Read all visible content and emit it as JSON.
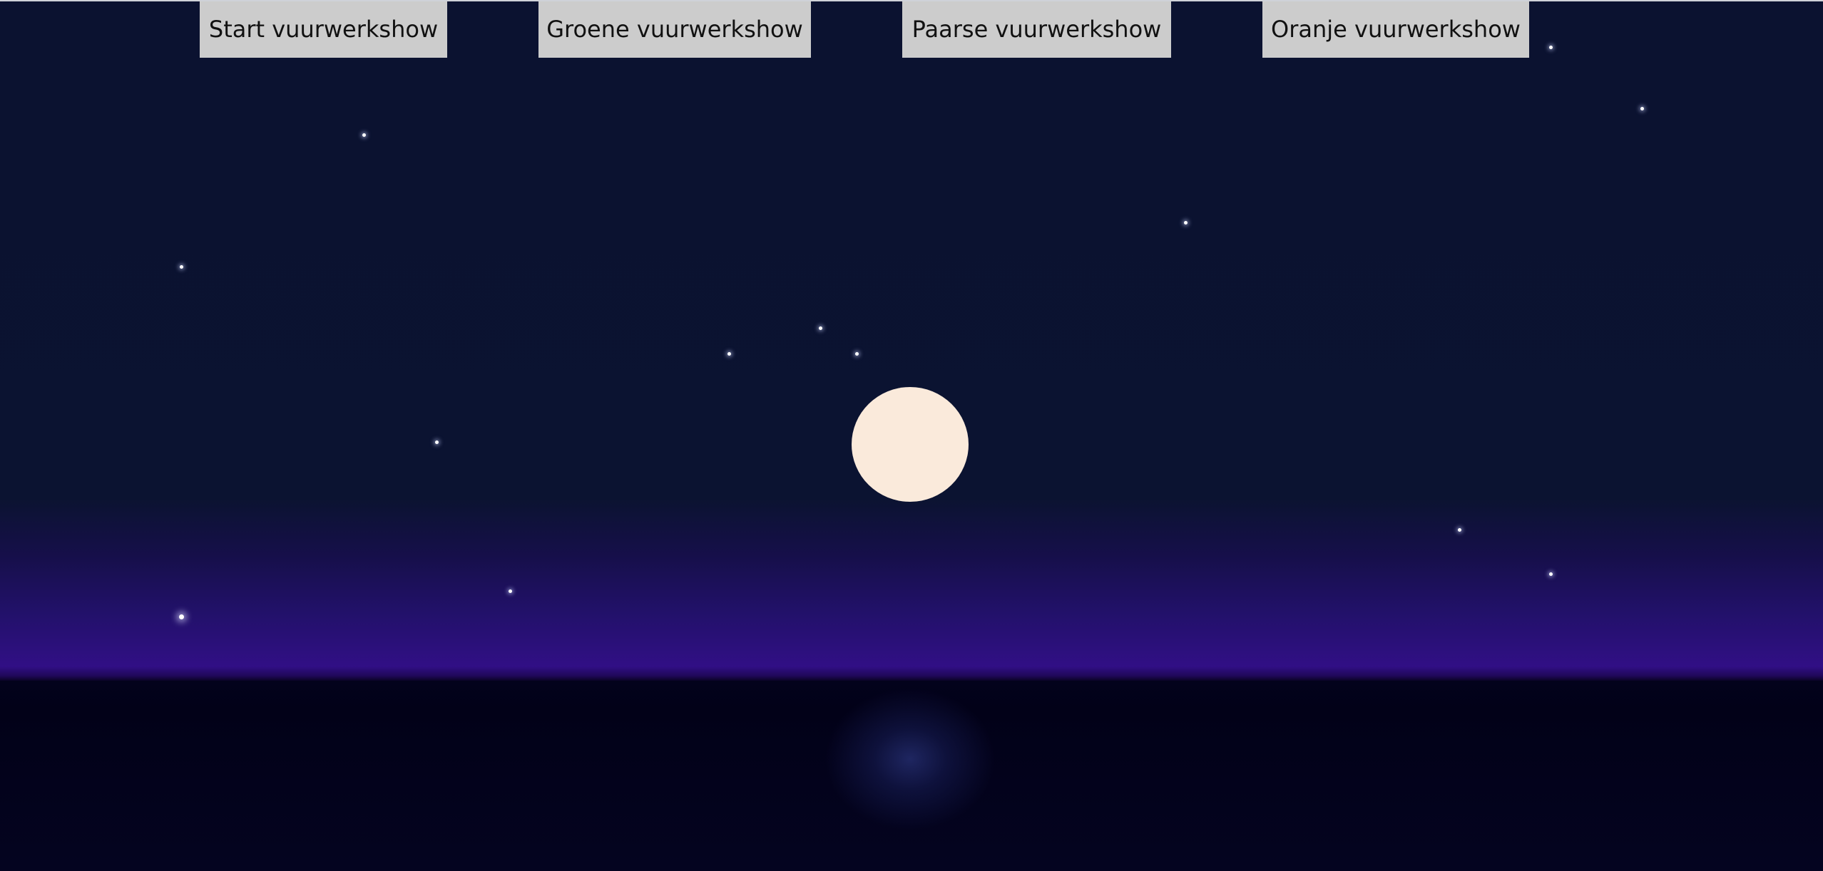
{
  "buttons": {
    "start": "Start vuurwerkshow",
    "green": "Groene vuurwerkshow",
    "purple": "Paarse vuurwerkshow",
    "orange": "Oranje vuurwerkshow"
  },
  "colors": {
    "sky_top": "#0b1230",
    "horizon_purple": "#310f85",
    "ground": "#03021c",
    "moon": "#faeadb",
    "button_bg": "#cccccc",
    "star": "#ffffff"
  },
  "icons": {
    "moon": "moon-icon",
    "star": "star-icon"
  }
}
